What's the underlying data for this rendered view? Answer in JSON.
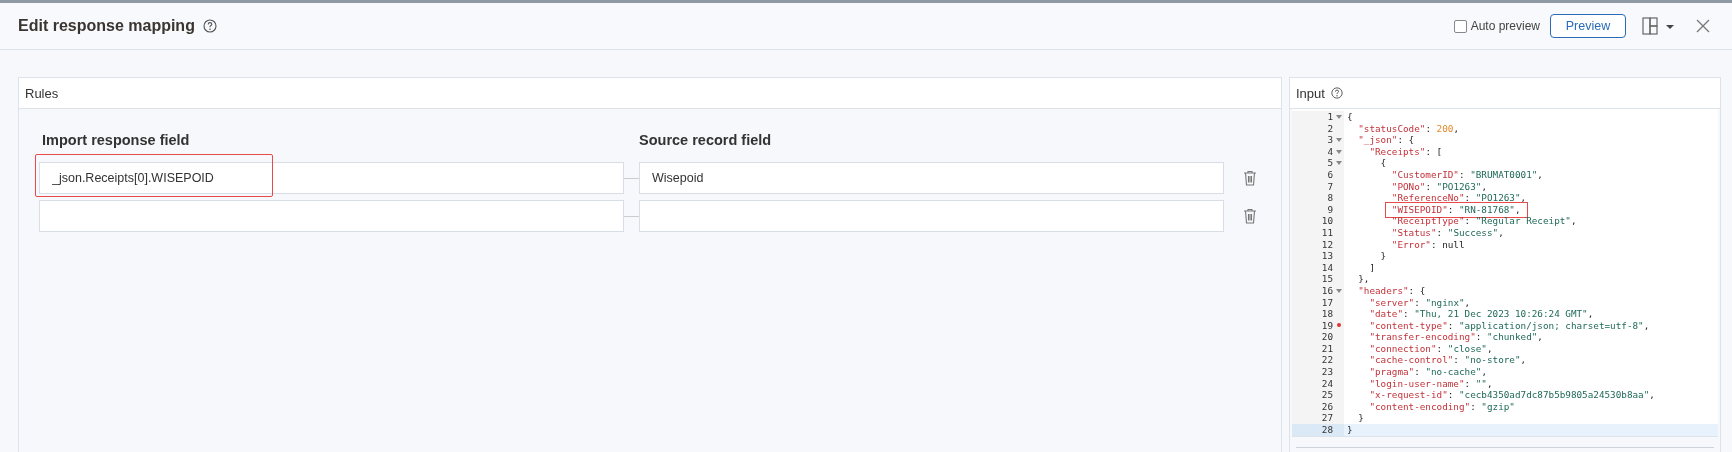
{
  "header": {
    "title": "Edit response mapping",
    "auto_preview": {
      "label": "Auto preview",
      "checked": false
    },
    "preview_button": "Preview"
  },
  "rules": {
    "title": "Rules",
    "columns": [
      "Import response field",
      "Source record field"
    ],
    "rows": [
      {
        "import_field": "_json.Receipts[0].WISEPOID",
        "source_field": "Wisepoid",
        "highlighted": true
      },
      {
        "highlighted": false
      }
    ]
  },
  "input": {
    "title": "Input",
    "lines": [
      {
        "number": "1",
        "fold": true,
        "error": false,
        "highlighted": false,
        "active": false,
        "text": "{"
      },
      {
        "number": "2",
        "fold": false,
        "error": false,
        "highlighted": false,
        "active": false,
        "text": "  \"statusCode\": 200,"
      },
      {
        "number": "3",
        "fold": true,
        "error": false,
        "highlighted": false,
        "active": false,
        "text": "  \"_json\": {"
      },
      {
        "number": "4",
        "fold": true,
        "error": false,
        "highlighted": false,
        "active": false,
        "text": "    \"Receipts\": ["
      },
      {
        "number": "5",
        "fold": true,
        "error": false,
        "highlighted": false,
        "active": false,
        "text": "      {"
      },
      {
        "number": "6",
        "fold": false,
        "error": false,
        "highlighted": false,
        "active": false,
        "text": "        \"CustomerID\": \"BRUMAT0001\","
      },
      {
        "number": "7",
        "fold": false,
        "error": false,
        "highlighted": false,
        "active": false,
        "text": "        \"PONo\": \"PO1263\","
      },
      {
        "number": "8",
        "fold": false,
        "error": false,
        "highlighted": false,
        "active": false,
        "text": "        \"ReferenceNo\": \"PO1263\","
      },
      {
        "number": "9",
        "fold": false,
        "error": false,
        "highlighted": true,
        "active": false,
        "text": "        \"WISEPOID\": \"RN-81768\","
      },
      {
        "number": "10",
        "fold": false,
        "error": false,
        "highlighted": false,
        "active": false,
        "text": "        \"ReceiptType\": \"Regular Receipt\","
      },
      {
        "number": "11",
        "fold": false,
        "error": false,
        "highlighted": false,
        "active": false,
        "text": "        \"Status\": \"Success\","
      },
      {
        "number": "12",
        "fold": false,
        "error": false,
        "highlighted": false,
        "active": false,
        "text": "        \"Error\": null"
      },
      {
        "number": "13",
        "fold": false,
        "error": false,
        "highlighted": false,
        "active": false,
        "text": "      }"
      },
      {
        "number": "14",
        "fold": false,
        "error": false,
        "highlighted": false,
        "active": false,
        "text": "    ]"
      },
      {
        "number": "15",
        "fold": false,
        "error": false,
        "highlighted": false,
        "active": false,
        "text": "  },"
      },
      {
        "number": "16",
        "fold": true,
        "error": false,
        "highlighted": false,
        "active": false,
        "text": "  \"headers\": {"
      },
      {
        "number": "17",
        "fold": false,
        "error": false,
        "highlighted": false,
        "active": false,
        "text": "    \"server\": \"nginx\","
      },
      {
        "number": "18",
        "fold": false,
        "error": false,
        "highlighted": false,
        "active": false,
        "text": "    \"date\": \"Thu, 21 Dec 2023 10:26:24 GMT\","
      },
      {
        "number": "19",
        "fold": false,
        "error": true,
        "highlighted": false,
        "active": false,
        "text": "    \"content-type\": \"application/json; charset=utf-8\","
      },
      {
        "number": "20",
        "fold": false,
        "error": false,
        "highlighted": false,
        "active": false,
        "text": "    \"transfer-encoding\": \"chunked\","
      },
      {
        "number": "21",
        "fold": false,
        "error": false,
        "highlighted": false,
        "active": false,
        "text": "    \"connection\": \"close\","
      },
      {
        "number": "22",
        "fold": false,
        "error": false,
        "highlighted": false,
        "active": false,
        "text": "    \"cache-control\": \"no-store\","
      },
      {
        "number": "23",
        "fold": false,
        "error": false,
        "highlighted": false,
        "active": false,
        "text": "    \"pragma\": \"no-cache\","
      },
      {
        "number": "24",
        "fold": false,
        "error": false,
        "highlighted": false,
        "active": false,
        "text": "    \"login-user-name\": \"\","
      },
      {
        "number": "25",
        "fold": false,
        "error": false,
        "highlighted": false,
        "active": false,
        "text": "    \"x-request-id\": \"cecb4350ad7dc87b5b9805a24530b8aa\","
      },
      {
        "number": "26",
        "fold": false,
        "error": false,
        "highlighted": false,
        "active": false,
        "text": "    \"content-encoding\": \"gzip\""
      },
      {
        "number": "27",
        "fold": false,
        "error": false,
        "highlighted": false,
        "active": false,
        "text": "  }"
      },
      {
        "number": "28",
        "fold": false,
        "error": false,
        "highlighted": false,
        "active": true,
        "text": "}"
      }
    ]
  }
}
